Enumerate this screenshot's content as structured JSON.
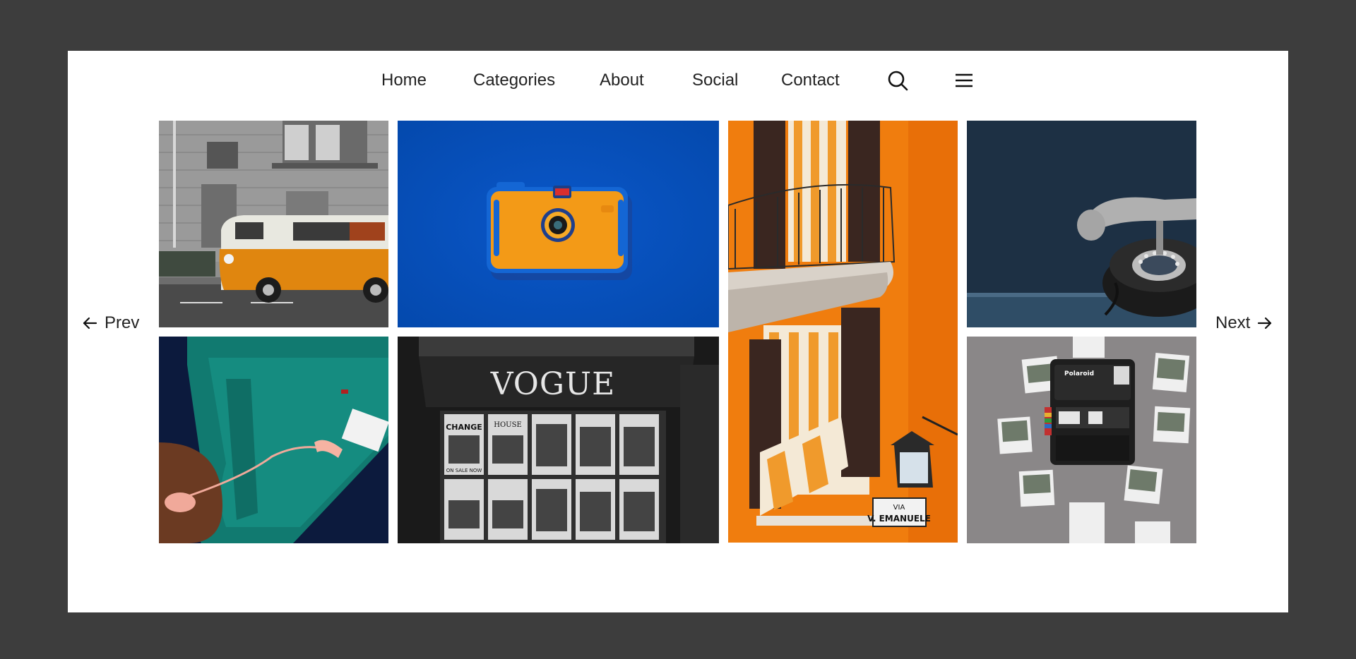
{
  "nav": {
    "items": [
      {
        "label": "Home"
      },
      {
        "label": "Categories"
      },
      {
        "label": "About"
      },
      {
        "label": "Social"
      },
      {
        "label": "Contact"
      }
    ],
    "search_icon": "search-icon",
    "menu_icon": "hamburger-menu-icon"
  },
  "gallery": {
    "prev_label": "Prev",
    "next_label": "Next",
    "prev_icon": "arrow-left-icon",
    "next_icon": "arrow-right-icon",
    "images": [
      {
        "subject": "orange-vw-van"
      },
      {
        "subject": "orange-camera-on-blue"
      },
      {
        "subject": "orange-building-balconies"
      },
      {
        "subject": "vintage-telephone"
      },
      {
        "subject": "teal-sofa-with-phone"
      },
      {
        "subject": "vogue-newsstand"
      },
      {
        "subject": "polaroid-camera-with-photos"
      }
    ],
    "vogue_sign": "VOGUE",
    "street_sign": [
      "VIA",
      "V. EMANUELE"
    ],
    "newsstand_headlines": [
      "CHANGE",
      "HOUSE",
      "ON SALE NOW"
    ],
    "camera_brand": "Polaroid"
  },
  "colors": {
    "page_background": "#3d3d3d",
    "card_background": "#ffffff",
    "text": "#222222"
  }
}
